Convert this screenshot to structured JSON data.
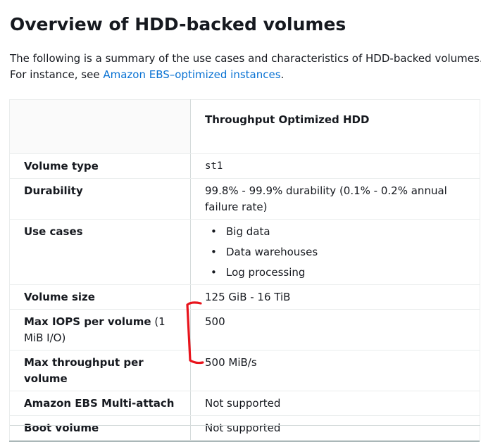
{
  "page": {
    "title": "Overview of HDD-backed volumes",
    "intro_text": "The following is a summary of the use cases and characteristics of HDD-backed volumes. For instance, see ",
    "intro_link": "Amazon EBS–optimized instances",
    "intro_end": "."
  },
  "table": {
    "header": "Throughput Optimized HDD",
    "rows": {
      "volume_type": {
        "label": "Volume type",
        "value": "st1"
      },
      "durability": {
        "label": "Durability",
        "value": "99.8% - 99.9% durability (0.1% - 0.2% annual failure rate)"
      },
      "use_cases": {
        "label": "Use cases",
        "items": [
          "Big data",
          "Data warehouses",
          "Log processing"
        ]
      },
      "volume_size": {
        "label": "Volume size",
        "value": "125 GiB - 16 TiB"
      },
      "max_iops": {
        "label": "Max IOPS per volume",
        "label_suffix": " (1 MiB I/O)",
        "value": "500"
      },
      "max_throughput": {
        "label": "Max throughput per volume",
        "value": "500 MiB/s"
      },
      "multi_attach": {
        "label": "Amazon EBS Multi-attach",
        "value": "Not supported"
      },
      "boot_volume": {
        "label": "Boot volume",
        "value": "Not supported"
      }
    }
  },
  "colors": {
    "link": "#0972d3",
    "annotation": "#e8141c",
    "text": "#16191f"
  }
}
